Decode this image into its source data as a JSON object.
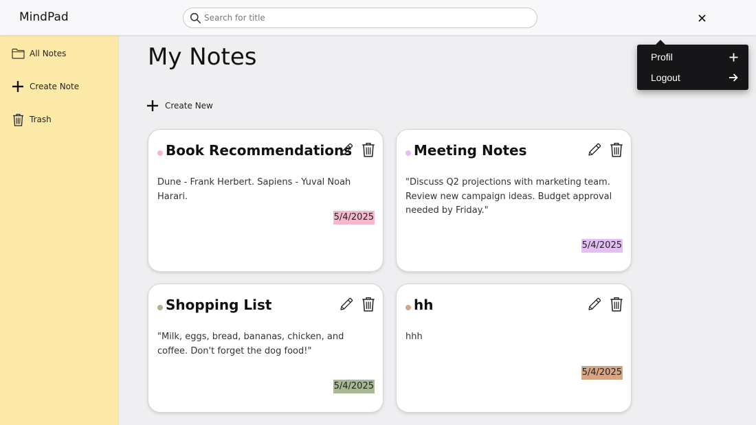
{
  "app": {
    "title": "MindPad"
  },
  "search": {
    "placeholder": "Search for title",
    "value": ""
  },
  "sidebar": {
    "items": [
      {
        "label": "All Notes",
        "icon": "folder-icon"
      },
      {
        "label": "Create Note",
        "icon": "plus-icon"
      },
      {
        "label": "Trash",
        "icon": "trash-icon"
      }
    ]
  },
  "main": {
    "title": "My Notes",
    "create_new_label": "Create New"
  },
  "notes": [
    {
      "title": "Book Recommendations",
      "body": "Dune - Frank Herbert. Sapiens - Yuval Noah Harari.",
      "date": "5/4/2025",
      "color": "#f6b8cf"
    },
    {
      "title": "Meeting Notes",
      "body": "\"Discuss Q2 projections with marketing team. Review new campaign ideas. Budget approval needed by Friday.\"",
      "date": "5/4/2025",
      "color": "#e4bff3"
    },
    {
      "title": "Shopping List",
      "body": "\"Milk, eggs, bread, bananas, chicken, and coffee. Don't forget the dog food!\"",
      "date": "5/4/2025",
      "color": "#a9b894"
    },
    {
      "title": "hh",
      "body": "hhh",
      "date": "5/4/2025",
      "color": "#d8a583"
    }
  ],
  "dropdown": {
    "items": [
      {
        "label": "Profil",
        "icon": "plus-icon"
      },
      {
        "label": "Logout",
        "icon": "arrow-right-icon"
      }
    ]
  },
  "colors": {
    "sidebar": "#feeaa8",
    "background": "#efeef0",
    "dropdown": "#161618"
  }
}
